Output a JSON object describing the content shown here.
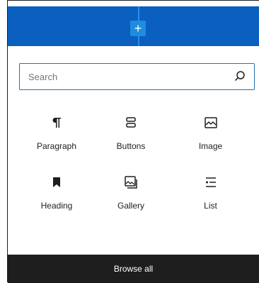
{
  "inserter": {
    "add_button_symbol": "+",
    "accent_color": "#0a5fbf",
    "search": {
      "placeholder": "Search",
      "value": ""
    },
    "blocks": [
      {
        "label": "Paragraph",
        "icon": "paragraph-icon"
      },
      {
        "label": "Buttons",
        "icon": "buttons-icon"
      },
      {
        "label": "Image",
        "icon": "image-icon"
      },
      {
        "label": "Heading",
        "icon": "heading-icon"
      },
      {
        "label": "Gallery",
        "icon": "gallery-icon"
      },
      {
        "label": "List",
        "icon": "list-icon"
      }
    ],
    "browse_all_label": "Browse all"
  }
}
